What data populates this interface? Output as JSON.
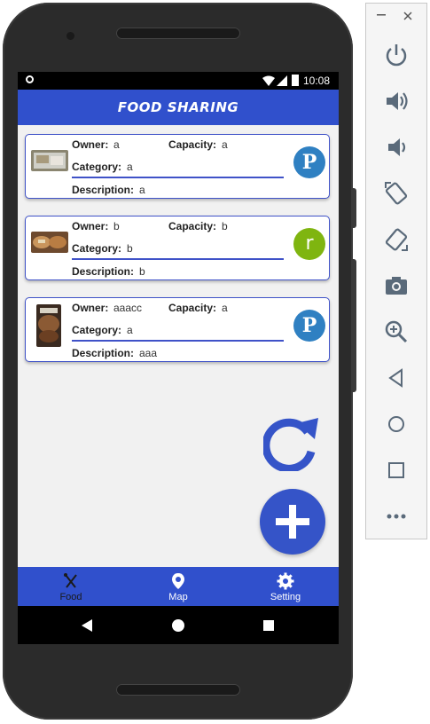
{
  "status_bar": {
    "time": "10:08"
  },
  "app": {
    "title": "FOOD SHARING"
  },
  "labels": {
    "owner": "Owner:",
    "capacity": "Capacity:",
    "category": "Category:",
    "description": "Description:"
  },
  "cards": [
    {
      "owner": "a",
      "capacity": "a",
      "category": "a",
      "description": "a",
      "avatar_letter": "P",
      "avatar_color": "#2f80c2"
    },
    {
      "owner": "b",
      "capacity": "b",
      "category": "b",
      "description": "b",
      "avatar_letter": "r",
      "avatar_color": "#7fb510"
    },
    {
      "owner": "aaacc",
      "capacity": "a",
      "category": "a",
      "description": "aaa",
      "avatar_letter": "P",
      "avatar_color": "#2f80c2"
    }
  ],
  "bottom_nav": [
    {
      "label": "Food",
      "icon": "fork-knife-icon"
    },
    {
      "label": "Map",
      "icon": "map-pin-icon"
    },
    {
      "label": "Setting",
      "icon": "gear-icon"
    }
  ],
  "colors": {
    "primary": "#3050cc",
    "card_border": "#3f52c8",
    "fab": "#3554c8"
  },
  "emulator_toolbar": [
    "close-icon",
    "minimize-icon",
    "power-icon",
    "volume-up-icon",
    "volume-down-icon",
    "rotate-left-icon",
    "rotate-right-icon",
    "camera-icon",
    "zoom-icon",
    "back-icon",
    "home-icon",
    "overview-icon",
    "more-icon"
  ]
}
